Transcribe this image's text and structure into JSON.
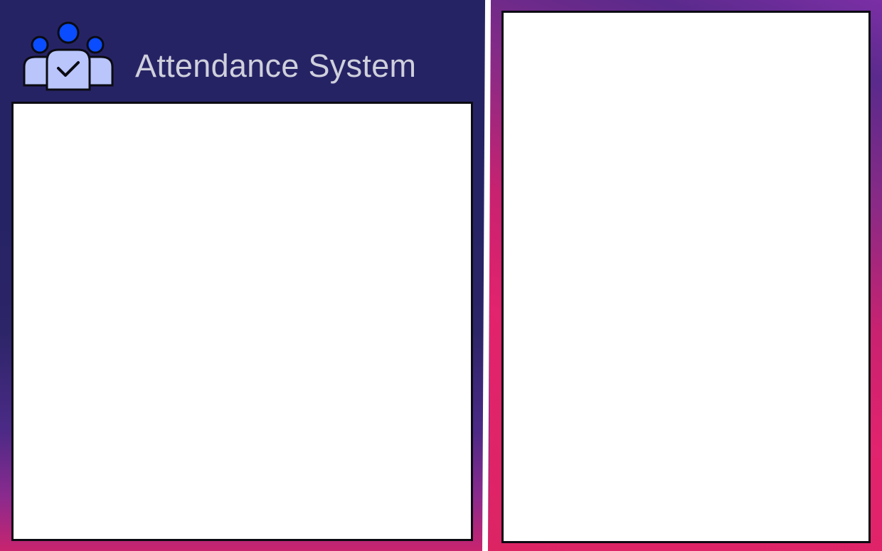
{
  "app": {
    "title": "Attendance System",
    "logo_icon": "attendance-group-icon"
  },
  "colors": {
    "header_bg": "#262365",
    "title_text": "#cfd0dc",
    "accent_pink": "#dc2468",
    "accent_purple": "#6c2f96",
    "icon_blue": "#0a4cff",
    "icon_light": "#b9c5fb",
    "panel_bg": "#ffffff"
  }
}
